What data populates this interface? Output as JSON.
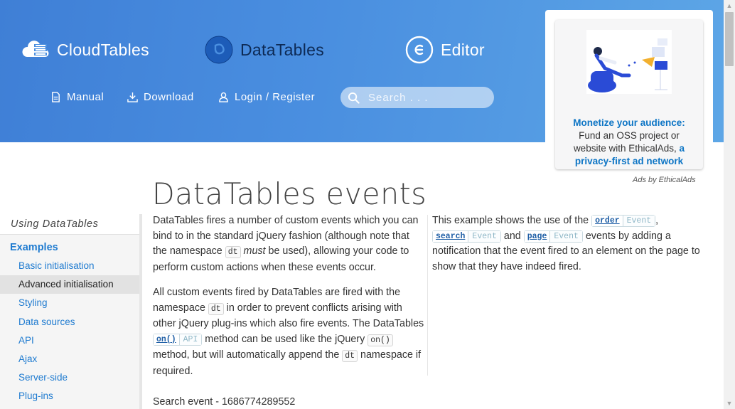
{
  "header": {
    "brands": [
      {
        "label": "CloudTables",
        "icon": "cloudtables-logo-icon"
      },
      {
        "label": "DataTables",
        "icon": "datatables-logo-icon"
      },
      {
        "label": "Editor",
        "icon": "editor-logo-icon"
      }
    ],
    "nav": [
      {
        "label": "Manual",
        "icon": "document-icon"
      },
      {
        "label": "Download",
        "icon": "download-icon"
      },
      {
        "label": "Login / Register",
        "icon": "user-icon"
      }
    ],
    "search": {
      "placeholder": "Search . . .",
      "icon": "search-icon"
    }
  },
  "ad": {
    "headline": "Monetize your audience:",
    "body": "Fund an OSS project or website with EthicalAds,",
    "link": "a privacy-first ad network",
    "attribution": "Ads by EthicalAds"
  },
  "page": {
    "title": "DataTables events"
  },
  "sidebar": {
    "heading": "Using DataTables",
    "section": "Examples",
    "items": [
      {
        "label": "Basic initialisation",
        "active": false
      },
      {
        "label": "Advanced initialisation",
        "active": true
      },
      {
        "label": "Styling",
        "active": false
      },
      {
        "label": "Data sources",
        "active": false
      },
      {
        "label": "API",
        "active": false
      },
      {
        "label": "Ajax",
        "active": false
      },
      {
        "label": "Server-side",
        "active": false
      },
      {
        "label": "Plug-ins",
        "active": false
      }
    ]
  },
  "content": {
    "p1": {
      "a": "DataTables fires a number of custom events which you can bind to in the standard jQuery fashion (although note that the namespace ",
      "code": "dt",
      "em": "must",
      "b": " be used), allowing your code to perform custom actions when these events occur."
    },
    "p2": {
      "a": "All custom events fired by DataTables are fired with the namespace ",
      "code1": "dt",
      "b": " in order to prevent conflicts arising with other jQuery plug-ins which also fire events. The DataTables ",
      "tag_name": "on()",
      "tag_type": "API",
      "c": " method can be used like the jQuery ",
      "code2": "on()",
      "d": " method, but will automatically append the ",
      "code3": "dt",
      "e": " namespace if required."
    },
    "p3": {
      "a": "This example shows the use of the ",
      "t1": "order",
      "sep1": ",",
      "t2": "search",
      "and": " and ",
      "t3": "page",
      "tag_type": "Event",
      "b": " events by adding a notification that the event fired to an element on the page to show that they have indeed fired."
    },
    "event_log": "Search event - 1686774289552"
  }
}
